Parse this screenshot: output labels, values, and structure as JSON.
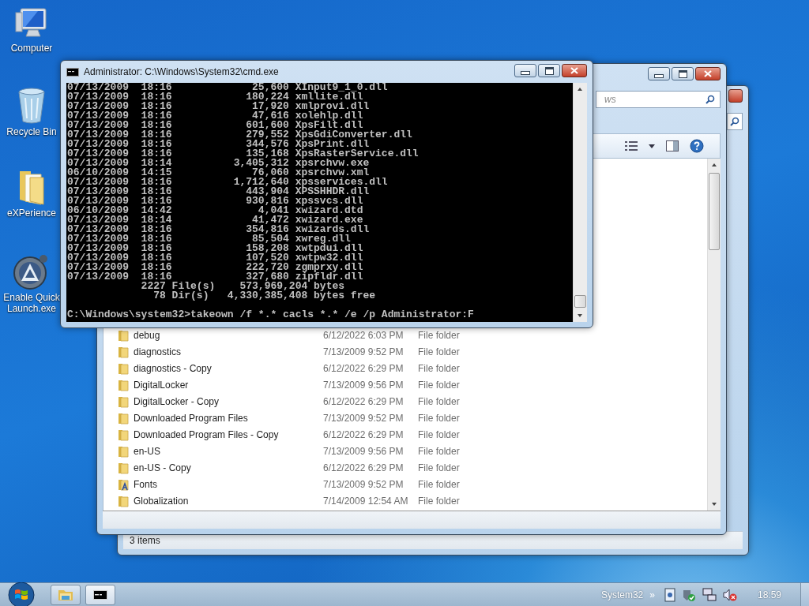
{
  "desktop_icons": [
    {
      "label": "Computer",
      "kind": "computer"
    },
    {
      "label": "Recycle Bin",
      "kind": "recycle-bin"
    },
    {
      "label": "eXPerience",
      "kind": "folder"
    },
    {
      "label": "Enable Quick Launch.exe",
      "kind": "app"
    }
  ],
  "explorer_back": {
    "status": "3 items"
  },
  "explorer_front": {
    "search_placeholder": "ws",
    "rows": [
      {
        "name": "debug",
        "date": "6/12/2022 6:03 PM",
        "type": "File folder",
        "kind": "folder"
      },
      {
        "name": "diagnostics",
        "date": "7/13/2009 9:52 PM",
        "type": "File folder",
        "kind": "folder"
      },
      {
        "name": "diagnostics - Copy",
        "date": "6/12/2022 6:29 PM",
        "type": "File folder",
        "kind": "folder"
      },
      {
        "name": "DigitalLocker",
        "date": "7/13/2009 9:56 PM",
        "type": "File folder",
        "kind": "folder"
      },
      {
        "name": "DigitalLocker - Copy",
        "date": "6/12/2022 6:29 PM",
        "type": "File folder",
        "kind": "folder"
      },
      {
        "name": "Downloaded Program Files",
        "date": "7/13/2009 9:52 PM",
        "type": "File folder",
        "kind": "folder"
      },
      {
        "name": "Downloaded Program Files - Copy",
        "date": "6/12/2022 6:29 PM",
        "type": "File folder",
        "kind": "folder"
      },
      {
        "name": "en-US",
        "date": "7/13/2009 9:56 PM",
        "type": "File folder",
        "kind": "folder"
      },
      {
        "name": "en-US - Copy",
        "date": "6/12/2022 6:29 PM",
        "type": "File folder",
        "kind": "folder"
      },
      {
        "name": "Fonts",
        "date": "7/13/2009 9:52 PM",
        "type": "File folder",
        "kind": "fonts"
      },
      {
        "name": "Globalization",
        "date": "7/14/2009 12:54 AM",
        "type": "File folder",
        "kind": "folder"
      }
    ]
  },
  "cmd_window": {
    "title": "Administrator: C:\\Windows\\System32\\cmd.exe",
    "lines": [
      "07/13/2009  18:16             25,600 XInput9_1_0.dll",
      "07/13/2009  18:16            180,224 xmllite.dll",
      "07/13/2009  18:16             17,920 xmlprovi.dll",
      "07/13/2009  18:16             47,616 xolehlp.dll",
      "07/13/2009  18:16            601,600 XpsFilt.dll",
      "07/13/2009  18:16            279,552 XpsGdiConverter.dll",
      "07/13/2009  18:16            344,576 XpsPrint.dll",
      "07/13/2009  18:16            135,168 XpsRasterService.dll",
      "07/13/2009  18:14          3,405,312 xpsrchvw.exe",
      "06/10/2009  14:15             76,060 xpsrchvw.xml",
      "07/13/2009  18:16          1,712,640 xpsservices.dll",
      "07/13/2009  18:16            443,904 XPSSHHDR.dll",
      "07/13/2009  18:16            930,816 xpssvcs.dll",
      "06/10/2009  14:42              4,041 xwizard.dtd",
      "07/13/2009  18:14             41,472 xwizard.exe",
      "07/13/2009  18:16            354,816 xwizards.dll",
      "07/13/2009  18:16             85,504 xwreg.dll",
      "07/13/2009  18:16            158,208 xwtpdui.dll",
      "07/13/2009  18:16            107,520 xwtpw32.dll",
      "07/13/2009  18:16            222,720 zgmprxy.dll",
      "07/13/2009  18:16            327,680 zipfldr.dll",
      "            2227 File(s)    573,969,204 bytes",
      "              78 Dir(s)   4,330,385,408 bytes free"
    ],
    "prompt": "C:\\Windows\\system32>takeown /f *.* cacls *.* /e /p Administrator:F"
  },
  "taskbar": {
    "buttons": [
      {
        "kind": "explorer"
      },
      {
        "kind": "console"
      }
    ],
    "toolbar_label": "System32",
    "overflow": "»",
    "clock": "18:59"
  }
}
